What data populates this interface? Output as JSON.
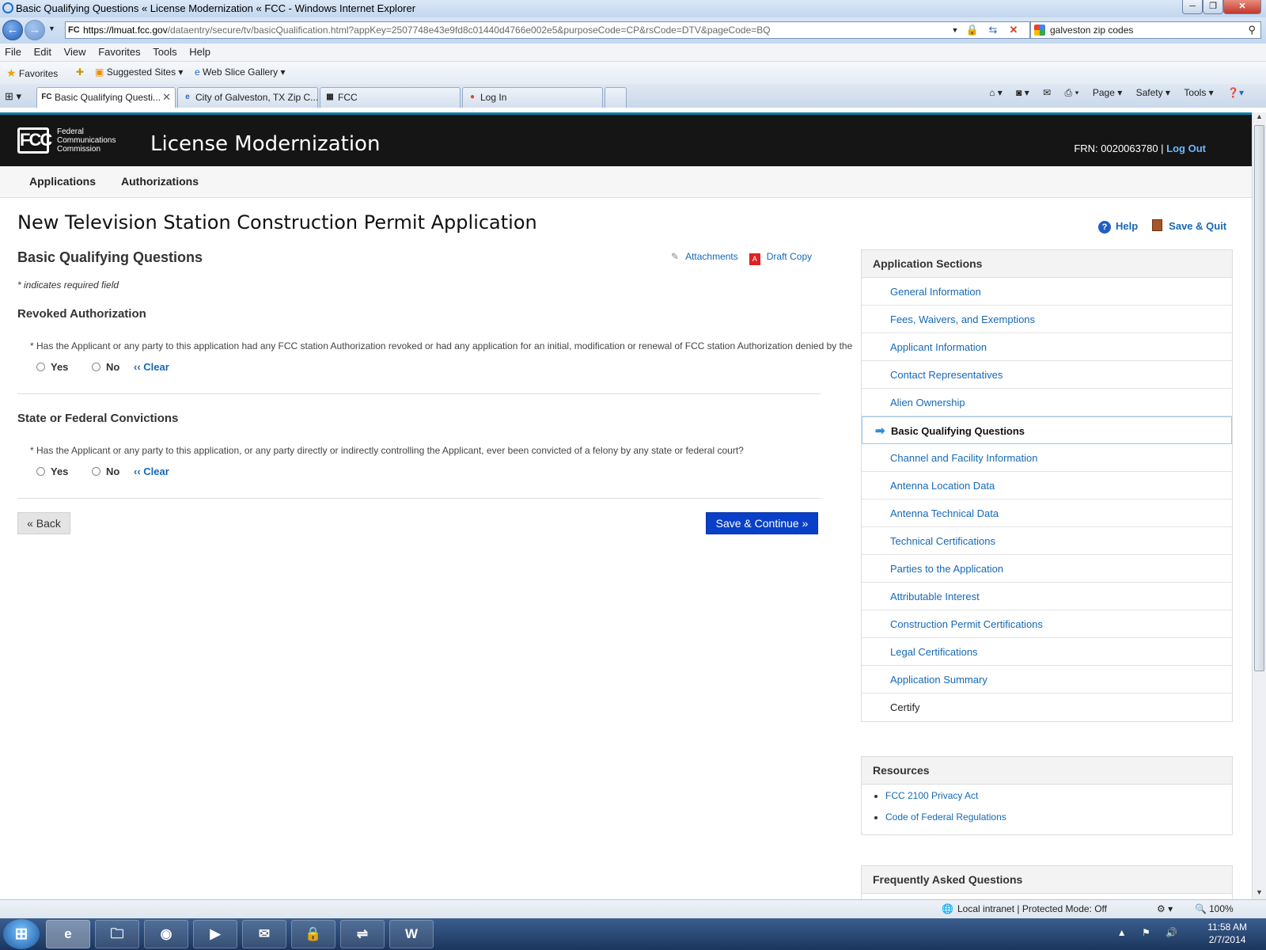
{
  "window": {
    "title": "Basic Qualifying Questions « License Modernization « FCC - Windows Internet Explorer"
  },
  "address": {
    "favicon": "FC",
    "domain": "https://lmuat.fcc.gov",
    "path": "/dataentry/secure/tv/basicQualification.html?appKey=2507748e43e9fd8c01440d4766e002e5&purposeCode=CP&rsCode=DTV&pageCode=BQ",
    "search_value": "galveston zip codes"
  },
  "menu": [
    "File",
    "Edit",
    "View",
    "Favorites",
    "Tools",
    "Help"
  ],
  "favorites": {
    "label": "Favorites",
    "suggested": "Suggested Sites ▾",
    "webslice": "Web Slice Gallery ▾"
  },
  "tabs": [
    {
      "label": "Basic Qualifying Questi...",
      "icon": "FC"
    },
    {
      "label": "City of Galveston, TX Zip C...",
      "icon": "e"
    },
    {
      "label": "FCC",
      "icon": "▦"
    },
    {
      "label": "Log In",
      "icon": "●"
    }
  ],
  "commandbar": {
    "page": "Page ▾",
    "safety": "Safety ▾",
    "tools": "Tools ▾"
  },
  "site": {
    "agency_line1": "Federal",
    "agency_line2": "Communications",
    "agency_line3": "Commission",
    "logo": "FCC",
    "app_title": "License Modernization",
    "frn": "FRN: 0020063780  |",
    "logout": "Log Out",
    "nav": [
      "Applications",
      "Authorizations"
    ]
  },
  "page": {
    "title": "New Television Station Construction Permit Application",
    "help": "Help",
    "save_quit": "Save & Quit",
    "section_title": "Basic Qualifying Questions",
    "attachments": "Attachments",
    "draft_copy": "Draft Copy",
    "required_note": "* indicates required field",
    "questions": [
      {
        "heading": "Revoked Authorization",
        "text": "* Has the Applicant or any party to this application had any FCC station Authorization revoked or had any application for an initial, modification or renewal of FCC station Authorization denied by the",
        "yes": "Yes",
        "no": "No",
        "clear": "‹‹ Clear"
      },
      {
        "heading": "State or Federal Convictions",
        "text": "* Has the Applicant or any party to this application, or any party directly or indirectly controlling the Applicant, ever been convicted of a felony by any state or federal court?",
        "yes": "Yes",
        "no": "No",
        "clear": "‹‹ Clear"
      }
    ],
    "back": "« Back",
    "save_continue": "Save & Continue »"
  },
  "sidebar": {
    "heading": "Application Sections",
    "items": [
      "General Information",
      "Fees, Waivers, and Exemptions",
      "Applicant Information",
      "Contact Representatives",
      "Alien Ownership",
      "Basic Qualifying Questions",
      "Channel and Facility Information",
      "Antenna Location Data",
      "Antenna Technical Data",
      "Technical Certifications",
      "Parties to the Application",
      "Attributable Interest",
      "Construction Permit Certifications",
      "Legal Certifications",
      "Application Summary",
      "Certify"
    ],
    "current": "Basic Qualifying Questions"
  },
  "resources": {
    "heading": "Resources",
    "items": [
      "FCC 2100 Privacy Act",
      "Code of Federal Regulations"
    ]
  },
  "faq": {
    "heading": "Frequently Asked Questions"
  },
  "status": {
    "zone": "Local intranet | Protected Mode: Off",
    "zoom": "100%"
  },
  "clock": {
    "time": "11:58 AM",
    "date": "2/7/2014"
  }
}
